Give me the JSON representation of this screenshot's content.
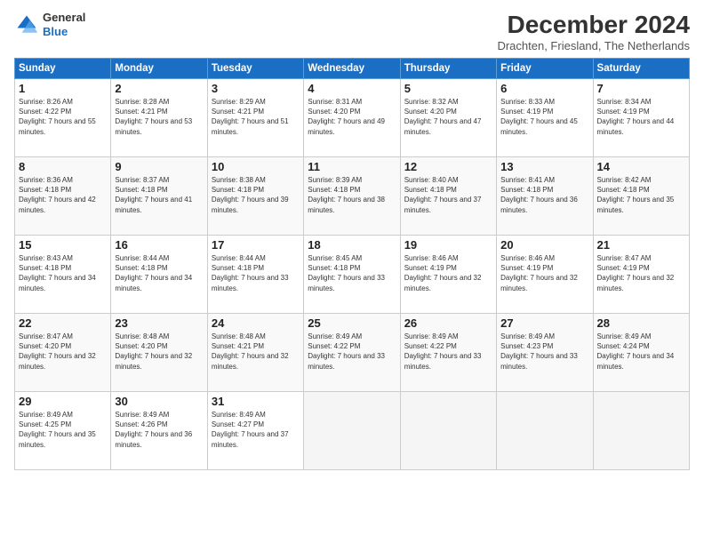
{
  "logo": {
    "line1": "General",
    "line2": "Blue"
  },
  "title": "December 2024",
  "location": "Drachten, Friesland, The Netherlands",
  "days_of_week": [
    "Sunday",
    "Monday",
    "Tuesday",
    "Wednesday",
    "Thursday",
    "Friday",
    "Saturday"
  ],
  "weeks": [
    [
      {
        "day": "1",
        "sunrise": "Sunrise: 8:26 AM",
        "sunset": "Sunset: 4:22 PM",
        "daylight": "Daylight: 7 hours and 55 minutes."
      },
      {
        "day": "2",
        "sunrise": "Sunrise: 8:28 AM",
        "sunset": "Sunset: 4:21 PM",
        "daylight": "Daylight: 7 hours and 53 minutes."
      },
      {
        "day": "3",
        "sunrise": "Sunrise: 8:29 AM",
        "sunset": "Sunset: 4:21 PM",
        "daylight": "Daylight: 7 hours and 51 minutes."
      },
      {
        "day": "4",
        "sunrise": "Sunrise: 8:31 AM",
        "sunset": "Sunset: 4:20 PM",
        "daylight": "Daylight: 7 hours and 49 minutes."
      },
      {
        "day": "5",
        "sunrise": "Sunrise: 8:32 AM",
        "sunset": "Sunset: 4:20 PM",
        "daylight": "Daylight: 7 hours and 47 minutes."
      },
      {
        "day": "6",
        "sunrise": "Sunrise: 8:33 AM",
        "sunset": "Sunset: 4:19 PM",
        "daylight": "Daylight: 7 hours and 45 minutes."
      },
      {
        "day": "7",
        "sunrise": "Sunrise: 8:34 AM",
        "sunset": "Sunset: 4:19 PM",
        "daylight": "Daylight: 7 hours and 44 minutes."
      }
    ],
    [
      {
        "day": "8",
        "sunrise": "Sunrise: 8:36 AM",
        "sunset": "Sunset: 4:18 PM",
        "daylight": "Daylight: 7 hours and 42 minutes."
      },
      {
        "day": "9",
        "sunrise": "Sunrise: 8:37 AM",
        "sunset": "Sunset: 4:18 PM",
        "daylight": "Daylight: 7 hours and 41 minutes."
      },
      {
        "day": "10",
        "sunrise": "Sunrise: 8:38 AM",
        "sunset": "Sunset: 4:18 PM",
        "daylight": "Daylight: 7 hours and 39 minutes."
      },
      {
        "day": "11",
        "sunrise": "Sunrise: 8:39 AM",
        "sunset": "Sunset: 4:18 PM",
        "daylight": "Daylight: 7 hours and 38 minutes."
      },
      {
        "day": "12",
        "sunrise": "Sunrise: 8:40 AM",
        "sunset": "Sunset: 4:18 PM",
        "daylight": "Daylight: 7 hours and 37 minutes."
      },
      {
        "day": "13",
        "sunrise": "Sunrise: 8:41 AM",
        "sunset": "Sunset: 4:18 PM",
        "daylight": "Daylight: 7 hours and 36 minutes."
      },
      {
        "day": "14",
        "sunrise": "Sunrise: 8:42 AM",
        "sunset": "Sunset: 4:18 PM",
        "daylight": "Daylight: 7 hours and 35 minutes."
      }
    ],
    [
      {
        "day": "15",
        "sunrise": "Sunrise: 8:43 AM",
        "sunset": "Sunset: 4:18 PM",
        "daylight": "Daylight: 7 hours and 34 minutes."
      },
      {
        "day": "16",
        "sunrise": "Sunrise: 8:44 AM",
        "sunset": "Sunset: 4:18 PM",
        "daylight": "Daylight: 7 hours and 34 minutes."
      },
      {
        "day": "17",
        "sunrise": "Sunrise: 8:44 AM",
        "sunset": "Sunset: 4:18 PM",
        "daylight": "Daylight: 7 hours and 33 minutes."
      },
      {
        "day": "18",
        "sunrise": "Sunrise: 8:45 AM",
        "sunset": "Sunset: 4:18 PM",
        "daylight": "Daylight: 7 hours and 33 minutes."
      },
      {
        "day": "19",
        "sunrise": "Sunrise: 8:46 AM",
        "sunset": "Sunset: 4:19 PM",
        "daylight": "Daylight: 7 hours and 32 minutes."
      },
      {
        "day": "20",
        "sunrise": "Sunrise: 8:46 AM",
        "sunset": "Sunset: 4:19 PM",
        "daylight": "Daylight: 7 hours and 32 minutes."
      },
      {
        "day": "21",
        "sunrise": "Sunrise: 8:47 AM",
        "sunset": "Sunset: 4:19 PM",
        "daylight": "Daylight: 7 hours and 32 minutes."
      }
    ],
    [
      {
        "day": "22",
        "sunrise": "Sunrise: 8:47 AM",
        "sunset": "Sunset: 4:20 PM",
        "daylight": "Daylight: 7 hours and 32 minutes."
      },
      {
        "day": "23",
        "sunrise": "Sunrise: 8:48 AM",
        "sunset": "Sunset: 4:20 PM",
        "daylight": "Daylight: 7 hours and 32 minutes."
      },
      {
        "day": "24",
        "sunrise": "Sunrise: 8:48 AM",
        "sunset": "Sunset: 4:21 PM",
        "daylight": "Daylight: 7 hours and 32 minutes."
      },
      {
        "day": "25",
        "sunrise": "Sunrise: 8:49 AM",
        "sunset": "Sunset: 4:22 PM",
        "daylight": "Daylight: 7 hours and 33 minutes."
      },
      {
        "day": "26",
        "sunrise": "Sunrise: 8:49 AM",
        "sunset": "Sunset: 4:22 PM",
        "daylight": "Daylight: 7 hours and 33 minutes."
      },
      {
        "day": "27",
        "sunrise": "Sunrise: 8:49 AM",
        "sunset": "Sunset: 4:23 PM",
        "daylight": "Daylight: 7 hours and 33 minutes."
      },
      {
        "day": "28",
        "sunrise": "Sunrise: 8:49 AM",
        "sunset": "Sunset: 4:24 PM",
        "daylight": "Daylight: 7 hours and 34 minutes."
      }
    ],
    [
      {
        "day": "29",
        "sunrise": "Sunrise: 8:49 AM",
        "sunset": "Sunset: 4:25 PM",
        "daylight": "Daylight: 7 hours and 35 minutes."
      },
      {
        "day": "30",
        "sunrise": "Sunrise: 8:49 AM",
        "sunset": "Sunset: 4:26 PM",
        "daylight": "Daylight: 7 hours and 36 minutes."
      },
      {
        "day": "31",
        "sunrise": "Sunrise: 8:49 AM",
        "sunset": "Sunset: 4:27 PM",
        "daylight": "Daylight: 7 hours and 37 minutes."
      },
      null,
      null,
      null,
      null
    ]
  ]
}
